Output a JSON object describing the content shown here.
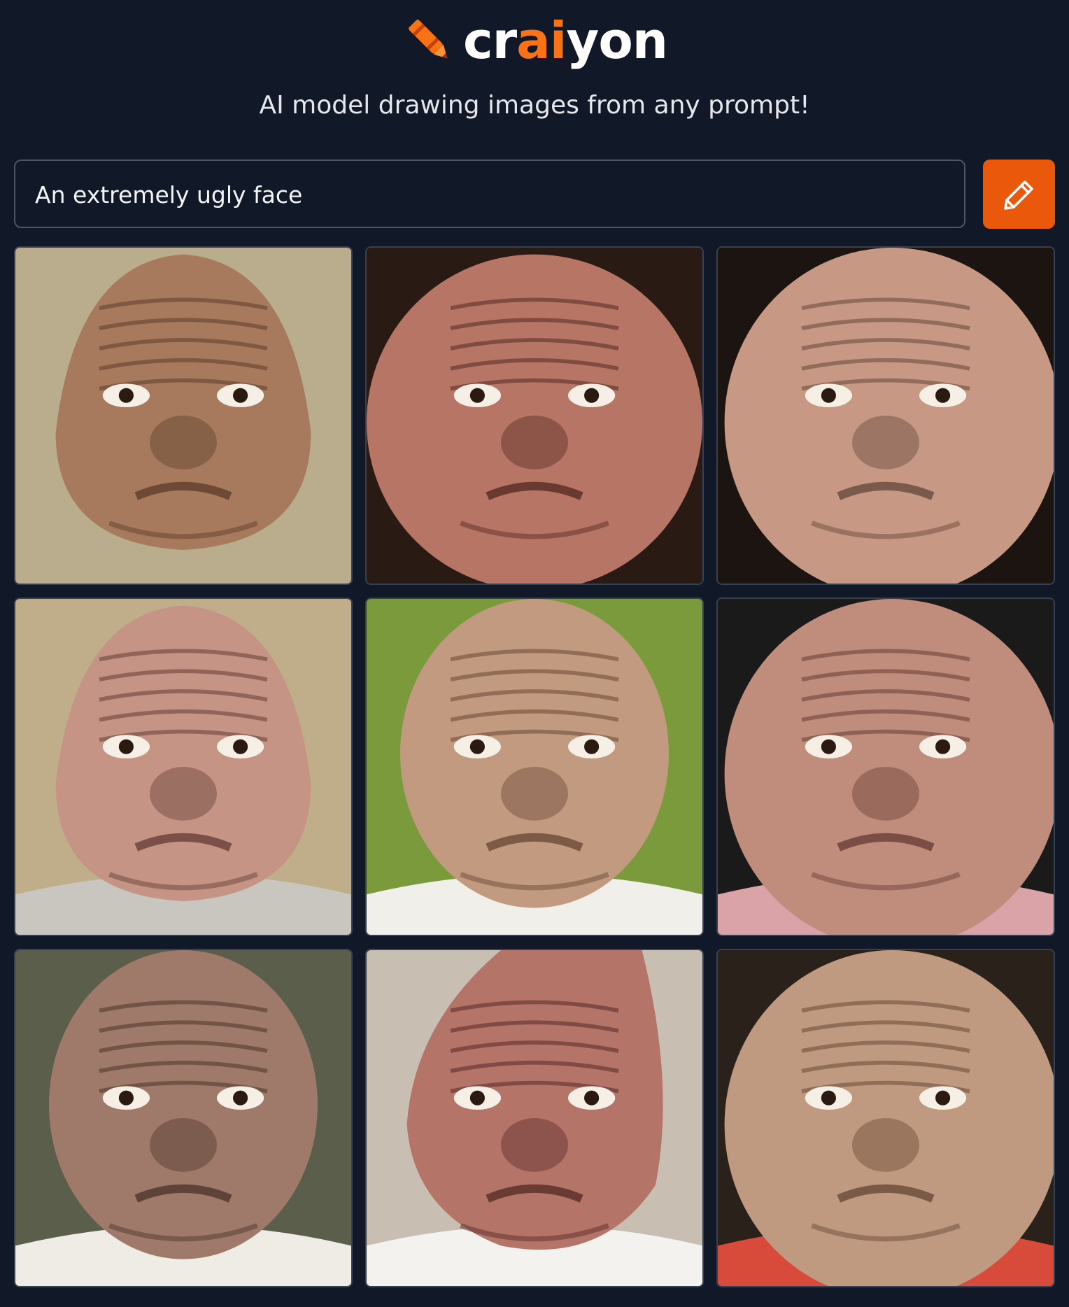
{
  "header": {
    "logo_parts": [
      "cr",
      "ai",
      "yon"
    ],
    "tagline": "AI model drawing images from any prompt!"
  },
  "prompt": {
    "value": "An extremely ugly face"
  },
  "draw_button": {
    "icon": "pencil-icon",
    "color": "#ea580c"
  },
  "colors": {
    "background": "#111827",
    "accent": "#f97316",
    "text": "#f3f4f6"
  },
  "gallery": {
    "columns": 3,
    "rows": 3,
    "images": [
      {
        "bg": "#b9ad8e",
        "skin": "#a77a5d",
        "shade": "#6e4a36",
        "clothing": "",
        "shape": "pear"
      },
      {
        "bg": "#2a1a14",
        "skin": "#b77665",
        "shade": "#6a3a30",
        "clothing": "",
        "shape": "blob"
      },
      {
        "bg": "#1c1410",
        "skin": "#c79883",
        "shade": "#7a5a4a",
        "clothing": "",
        "shape": "wide"
      },
      {
        "bg": "#c0ad8a",
        "skin": "#c69484",
        "shade": "#7a5048",
        "clothing": "#c9c6bf",
        "shape": "pear"
      },
      {
        "bg": "#7a9a3c",
        "skin": "#c19a80",
        "shade": "#7d5a45",
        "clothing": "#f0efe9",
        "shape": "oval"
      },
      {
        "bg": "#1a1a1a",
        "skin": "#c08c7b",
        "shade": "#7a4e44",
        "clothing": "#d9a3a8",
        "shape": "wide"
      },
      {
        "bg": "#5a5e4a",
        "skin": "#9f7a6a",
        "shade": "#5e4438",
        "clothing": "#eeece4",
        "shape": "oval"
      },
      {
        "bg": "#c8bfb2",
        "skin": "#b57468",
        "shade": "#6a3a34",
        "clothing": "#f4f2ee",
        "shape": "tilted"
      },
      {
        "bg": "#2a221a",
        "skin": "#c09a80",
        "shade": "#7a5a44",
        "clothing": "#d84a3a",
        "shape": "wide"
      }
    ]
  }
}
